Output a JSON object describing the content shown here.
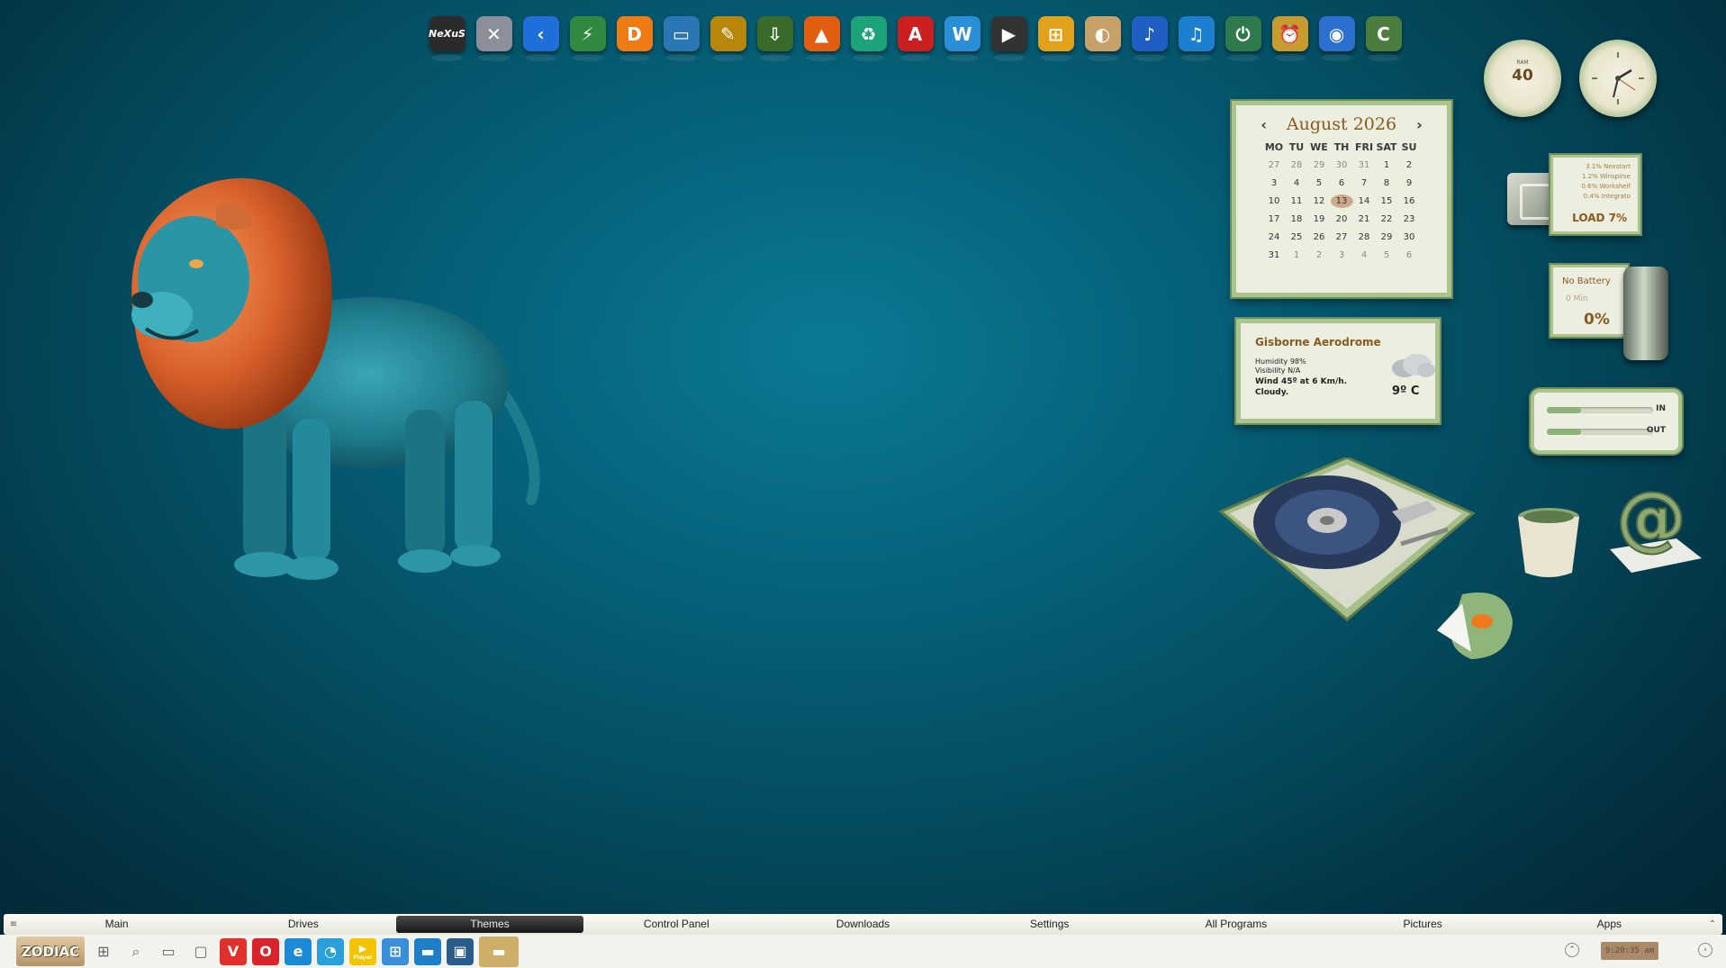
{
  "dock": {
    "items": [
      {
        "icon": "nexus-icon",
        "glyph": "NeXuS",
        "color": "#2b2b2b"
      },
      {
        "icon": "tools-icon",
        "glyph": "✕",
        "color": "#8a8f99"
      },
      {
        "icon": "back-arrow-icon",
        "glyph": "‹",
        "color": "#1e6fd9"
      },
      {
        "icon": "winamp-icon",
        "glyph": "⚡",
        "color": "#2f8a3f"
      },
      {
        "icon": "p-app-icon",
        "glyph": "D",
        "color": "#f07b14"
      },
      {
        "icon": "monitor-icon",
        "glyph": "▭",
        "color": "#2a77b5"
      },
      {
        "icon": "paint-brushes-icon",
        "glyph": "✎",
        "color": "#b8860b"
      },
      {
        "icon": "download-door-icon",
        "glyph": "⇩",
        "color": "#3a6a2a"
      },
      {
        "icon": "vlc-cone-icon",
        "glyph": "▲",
        "color": "#e35d10"
      },
      {
        "icon": "recycle-icon",
        "glyph": "♻",
        "color": "#1ca37a"
      },
      {
        "icon": "acrobat-icon",
        "glyph": "A",
        "color": "#cc1f1f"
      },
      {
        "icon": "w-app-icon",
        "glyph": "W",
        "color": "#2a8fd6"
      },
      {
        "icon": "video-camera-icon",
        "glyph": "▶",
        "color": "#333333"
      },
      {
        "icon": "windows-logo-icon",
        "glyph": "⊞",
        "color": "#e2a11c"
      },
      {
        "icon": "palette-icon",
        "glyph": "◐",
        "color": "#c6a16a"
      },
      {
        "icon": "music-note-icon",
        "glyph": "♪",
        "color": "#1f5fc4"
      },
      {
        "icon": "speaker-icon",
        "glyph": "♫",
        "color": "#1c7fcf"
      },
      {
        "icon": "power-icon",
        "glyph": "⏻",
        "color": "#2e7a4d"
      },
      {
        "icon": "alarm-clock-icon",
        "glyph": "⏰",
        "color": "#c89b2f"
      },
      {
        "icon": "globe-app-icon",
        "glyph": "◉",
        "color": "#2b6fd1"
      },
      {
        "icon": "drive-c-icon",
        "glyph": "C",
        "color": "#4a7d3e"
      }
    ]
  },
  "gauges": {
    "ram_value": "40",
    "ram_label": "RAM"
  },
  "calendar": {
    "month_title": "August 2026",
    "weekdays": [
      "MO",
      "TU",
      "WE",
      "TH",
      "FRI",
      "SAT",
      "SU"
    ],
    "weeks": [
      [
        "27",
        "28",
        "29",
        "30",
        "31",
        "1",
        "2"
      ],
      [
        "3",
        "4",
        "5",
        "6",
        "7",
        "8",
        "9"
      ],
      [
        "10",
        "11",
        "12",
        "13",
        "14",
        "15",
        "16"
      ],
      [
        "17",
        "18",
        "19",
        "20",
        "21",
        "22",
        "23"
      ],
      [
        "24",
        "25",
        "26",
        "27",
        "28",
        "29",
        "30"
      ],
      [
        "31",
        "1",
        "2",
        "3",
        "4",
        "5",
        "6"
      ]
    ],
    "today": "13"
  },
  "weather": {
    "location": "Gisborne Aerodrome",
    "humidity": "Humidity 98%",
    "visibility": "Visibility N/A",
    "wind": "Wind 45º at 6 Km/h.",
    "condition": "Cloudy.",
    "temperature": "9º C"
  },
  "cpu": {
    "processes": [
      "3.1% Nexstart",
      "1.2% Winspirse",
      "0.6% Workshelf",
      "0.4% Integrato"
    ],
    "load": "LOAD 7%"
  },
  "battery": {
    "status": "No Battery",
    "time": "0 Min",
    "percent": "0%"
  },
  "network": {
    "in_label": "IN",
    "out_label": "OUT",
    "in_level": 0.32,
    "out_level": 0.32
  },
  "categories": [
    "Main",
    "Drives",
    "Themes",
    "Control Panel",
    "Downloads",
    "Settings",
    "All Programs",
    "Pictures",
    "Apps"
  ],
  "active_category": "Themes",
  "taskbar": {
    "start_label": "ZODIAC",
    "apps": [
      {
        "icon": "windows-grid-icon",
        "glyph": "⊞",
        "color": "transparent"
      },
      {
        "icon": "search-icon",
        "glyph": "⌕",
        "color": "transparent"
      },
      {
        "icon": "task-view-icon",
        "glyph": "▭",
        "color": "transparent"
      },
      {
        "icon": "chat-icon",
        "glyph": "▢",
        "color": "transparent"
      },
      {
        "icon": "vivaldi-icon",
        "glyph": "V",
        "color": "#e0302c"
      },
      {
        "icon": "opera-icon",
        "glyph": "O",
        "color": "#d8232a"
      },
      {
        "icon": "edge-icon",
        "glyph": "e",
        "color": "#1d8ad6"
      },
      {
        "icon": "timer-app-icon",
        "glyph": "◔",
        "color": "#2aa0d9"
      },
      {
        "icon": "player-app-icon",
        "glyph": "▶",
        "color": "#f2c500"
      },
      {
        "icon": "windows-store-icon",
        "glyph": "⊞",
        "color": "#3b8fd9"
      },
      {
        "icon": "desktop-app-icon",
        "glyph": "▬",
        "color": "#1e7fc8"
      },
      {
        "icon": "computer-icon",
        "glyph": "▣",
        "color": "#2a5c8a"
      }
    ],
    "player_label": "Player",
    "clock": "9:20:35 am"
  }
}
